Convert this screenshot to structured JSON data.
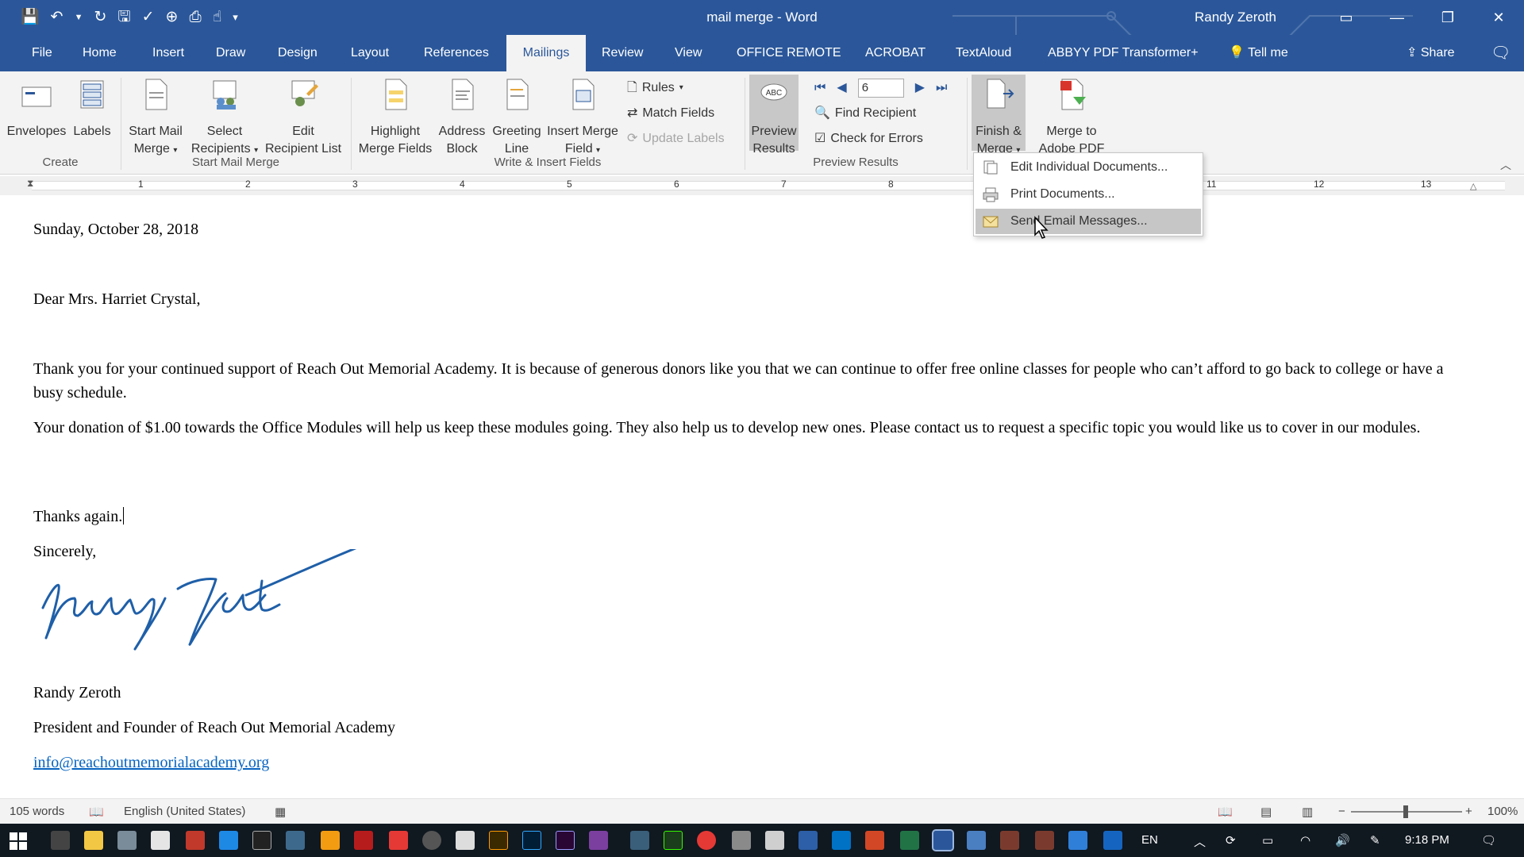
{
  "window": {
    "title": "mail merge  -  Word",
    "user": "Randy Zeroth",
    "controls": [
      "ribbon-display",
      "minimize",
      "restore",
      "close"
    ]
  },
  "tabs": {
    "items": [
      "File",
      "Home",
      "Insert",
      "Draw",
      "Design",
      "Layout",
      "References",
      "Mailings",
      "Review",
      "View",
      "OFFICE REMOTE",
      "ACROBAT",
      "TextAloud",
      "ABBYY PDF Transformer+"
    ],
    "active": "Mailings",
    "tell_me": "Tell me",
    "share": "Share"
  },
  "ribbon": {
    "create": {
      "label": "Create",
      "envelopes": "Envelopes",
      "labels": "Labels"
    },
    "start_mail_merge": {
      "label": "Start Mail Merge",
      "start_l1": "Start Mail",
      "start_l2": "Merge",
      "select_l1": "Select",
      "select_l2": "Recipients",
      "edit_l1": "Edit",
      "edit_l2": "Recipient List"
    },
    "write_insert": {
      "label": "Write & Insert Fields",
      "highlight_l1": "Highlight",
      "highlight_l2": "Merge Fields",
      "address_l1": "Address",
      "address_l2": "Block",
      "greeting_l1": "Greeting",
      "greeting_l2": "Line",
      "insert_l1": "Insert Merge",
      "insert_l2": "Field",
      "rules": "Rules",
      "match_fields": "Match Fields",
      "update_labels": "Update Labels"
    },
    "preview": {
      "label": "Preview Results",
      "preview_l1": "Preview",
      "preview_l2": "Results",
      "record": "6",
      "find_recipient": "Find Recipient",
      "check_errors": "Check for Errors"
    },
    "finish": {
      "finish_l1": "Finish &",
      "finish_l2": "Merge",
      "adobe_l1": "Merge to",
      "adobe_l2": "Adobe PDF"
    }
  },
  "finish_menu": {
    "items": [
      "Edit Individual Documents...",
      "Print Documents...",
      "Send Email Messages..."
    ],
    "highlighted": "Send Email Messages..."
  },
  "ruler": {
    "numbers": [
      "1",
      "2",
      "3",
      "4",
      "5",
      "6",
      "7",
      "8",
      "11",
      "12",
      "13"
    ]
  },
  "document": {
    "date": "Sunday, October 28, 2018",
    "salutation": "Dear Mrs. Harriet Crystal,",
    "para1": "Thank you for your continued support of Reach Out Memorial Academy. It is because of generous donors like you that we can continue to offer free online classes for people who can’t afford to go back to college or have a busy schedule.",
    "para2": "Your donation of $1.00 towards the Office Modules will help us keep these modules going. They also help us to develop new ones.  Please contact us to request a specific topic you would like us to cover in our modules.",
    "thanks": "Thanks again.",
    "closing": "Sincerely,",
    "signature_text": "Randy Zeroth",
    "name": "Randy Zeroth",
    "title": "President and Founder of Reach Out Memorial Academy",
    "email": "info@reachoutmemorialacademy.org"
  },
  "status": {
    "words": "105 words",
    "language": "English (United States)",
    "zoom": "100%"
  },
  "taskbar": {
    "lang": "EN",
    "time": "9:18 PM"
  },
  "colors": {
    "word_blue": "#2b579a",
    "ribbon_bg": "#f3f3f3",
    "link": "#0563c1",
    "signature": "#1f5fa8"
  }
}
